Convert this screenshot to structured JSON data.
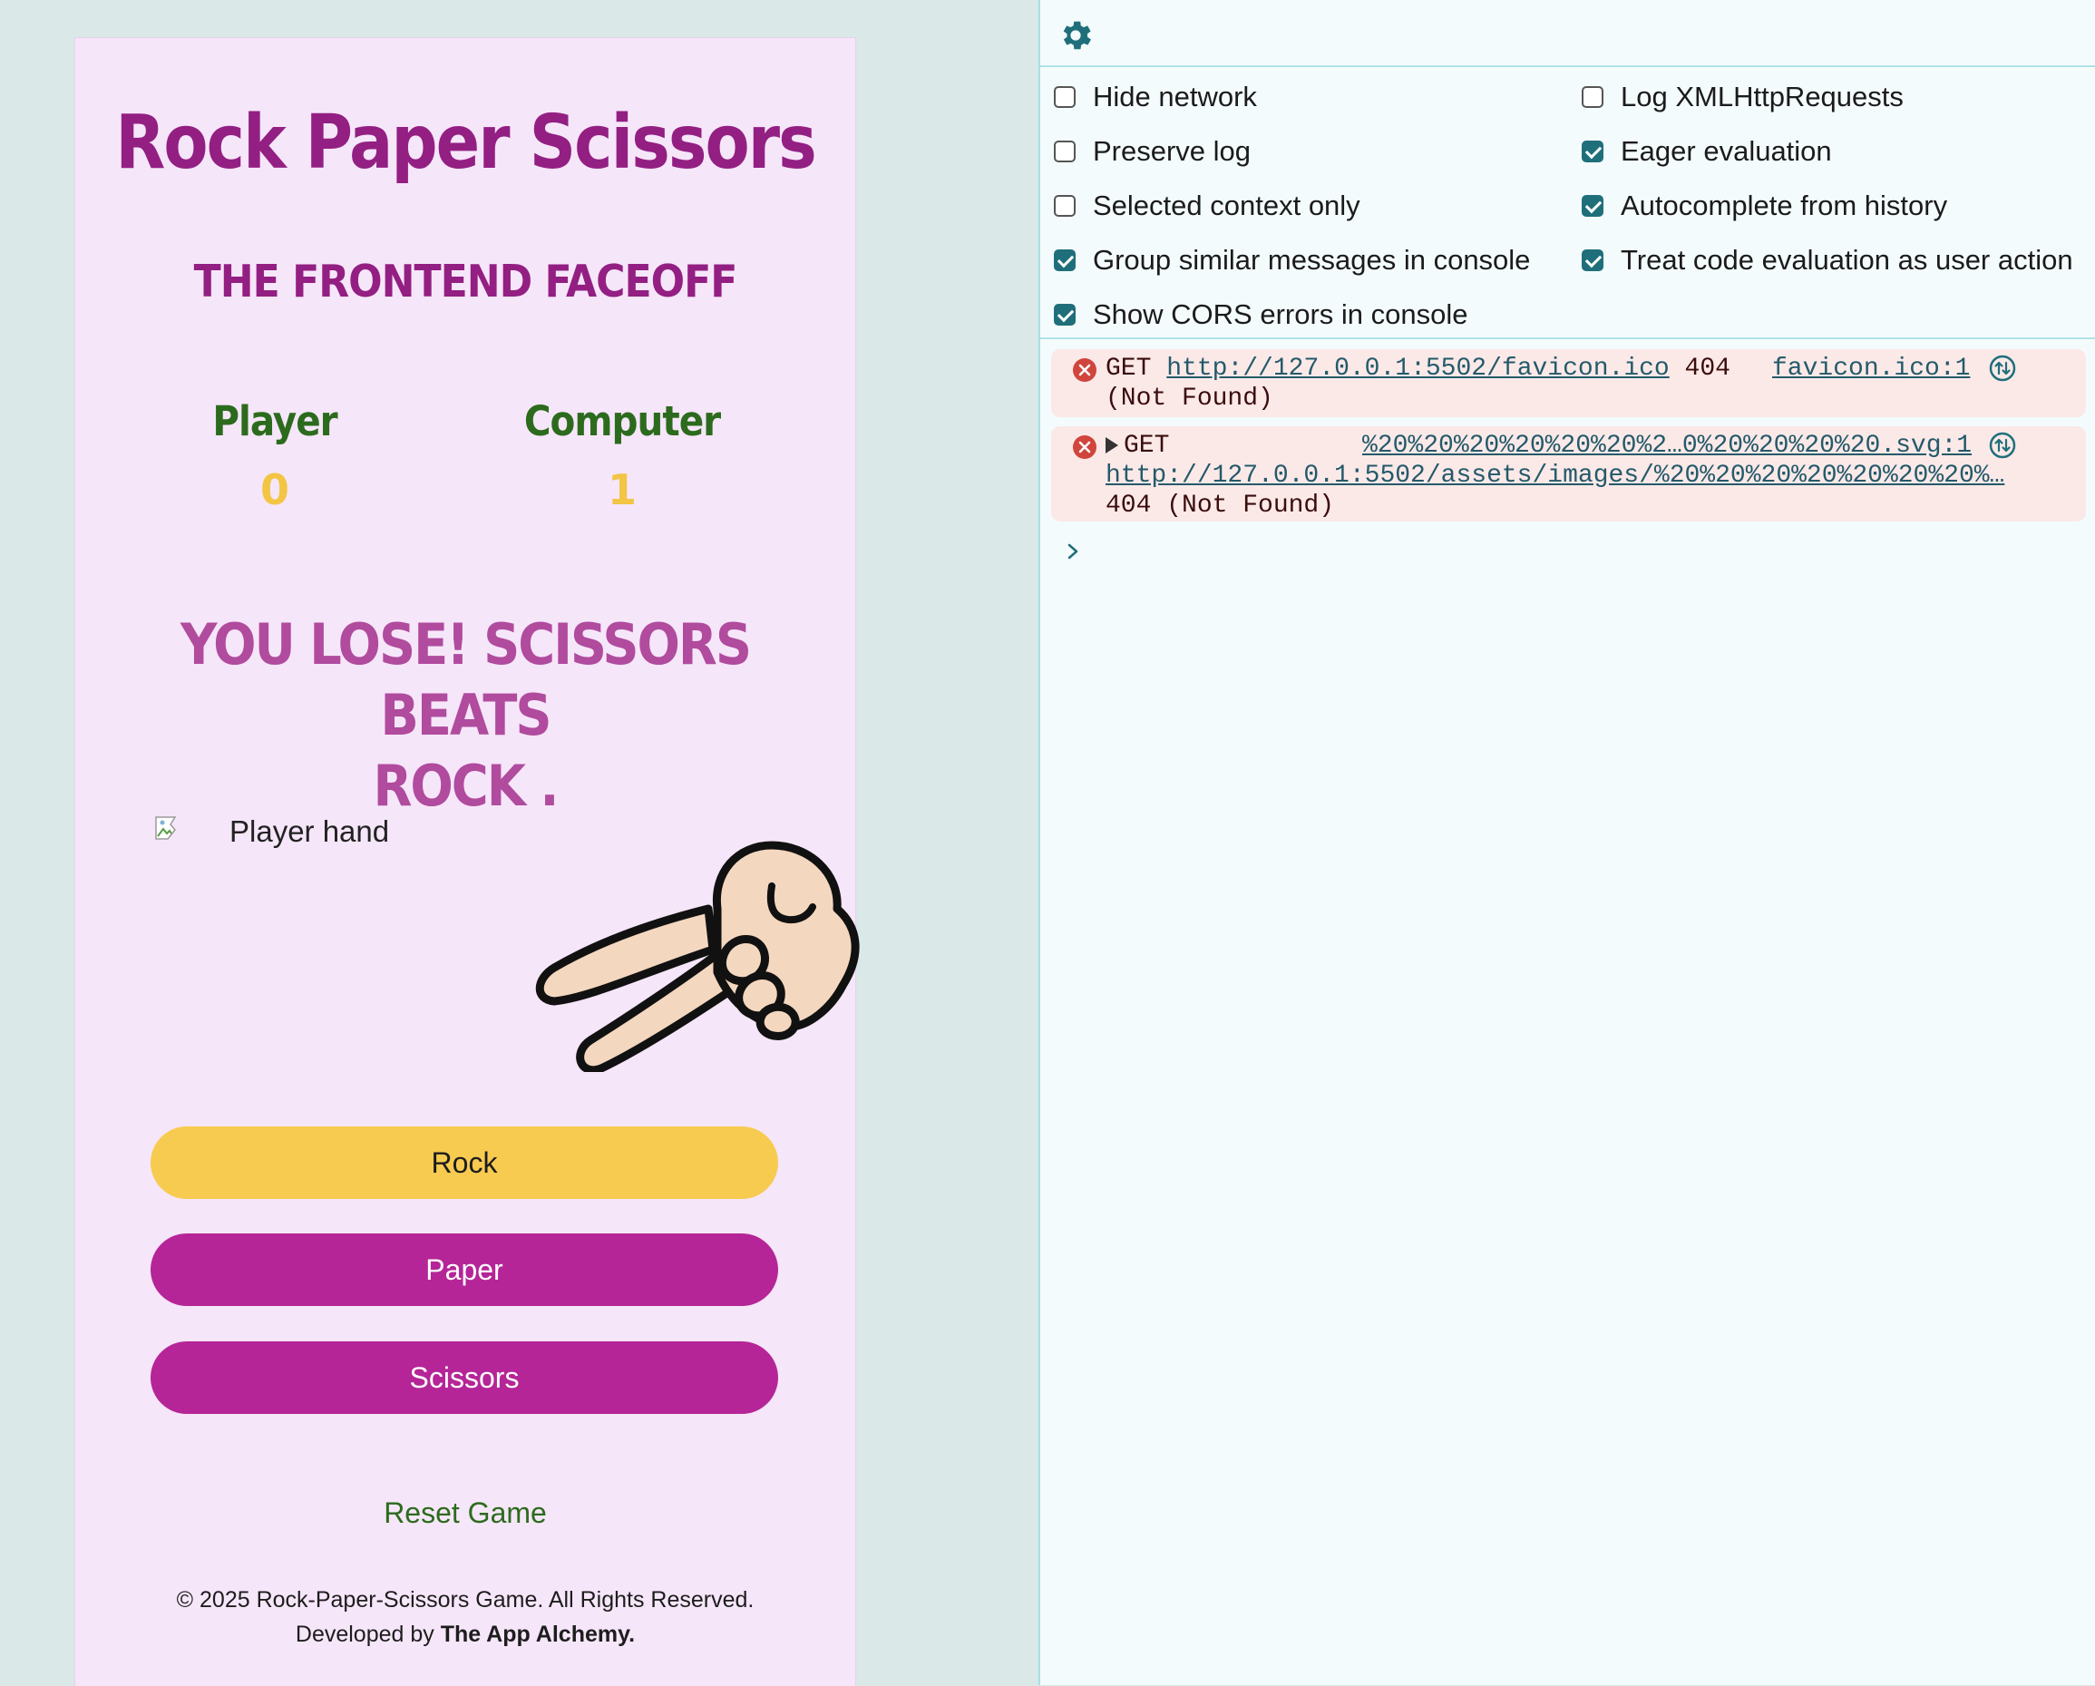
{
  "game": {
    "title": "Rock Paper Scissors",
    "subtitle": "THE FRONTEND FACEOFF",
    "player_label": "Player",
    "player_score": "0",
    "computer_label": "Computer",
    "computer_score": "1",
    "result_line1": "YOU LOSE! SCISSORS BEATS",
    "result_line2": "ROCK .",
    "player_img_alt": "Player hand",
    "buttons": {
      "rock": "Rock",
      "paper": "Paper",
      "scissors": "Scissors"
    },
    "reset_label": "Reset Game",
    "footer_line1": "© 2025 Rock-Paper-Scissors Game. All Rights Reserved.",
    "footer_prefix": "Developed by ",
    "footer_author": "The App Alchemy.",
    "colors": {
      "page_bg": "#dae8e8",
      "card_bg": "#f6e6f9",
      "title": "#931f83",
      "label_green": "#2c6b1d",
      "score_yellow": "#f2c544",
      "result": "#b04b9e",
      "rock_button": "#f7cb50",
      "paper_scissors_button": "#b52597"
    }
  },
  "devtools": {
    "settings_icon": "gear-icon",
    "settings": {
      "hide_network": {
        "label": "Hide network",
        "checked": false
      },
      "log_xhr": {
        "label": "Log XMLHttpRequests",
        "checked": false
      },
      "preserve_log": {
        "label": "Preserve log",
        "checked": false
      },
      "eager_eval": {
        "label": "Eager evaluation",
        "checked": true
      },
      "selected_context": {
        "label": "Selected context only",
        "checked": false
      },
      "autocomplete_history": {
        "label": "Autocomplete from history",
        "checked": true
      },
      "group_similar": {
        "label": "Group similar messages in console",
        "checked": true
      },
      "treat_user_action": {
        "label": "Treat code evaluation as user action",
        "checked": true
      },
      "show_cors": {
        "label": "Show CORS errors in console",
        "checked": true
      }
    },
    "logs": [
      {
        "method": "GET",
        "url": "http://127.0.0.1:5502/favicon.ico",
        "status": "404",
        "status_text": "(Not Found)",
        "source": "favicon.ico:1"
      },
      {
        "method": "GET",
        "url": "http://127.0.0.1:5502/assets/images/%20%20%20%20%20%20%20%…",
        "status_text": "404 (Not Found)",
        "source": "%20%20%20%20%20%20%2…0%20%20%20%20.svg:1"
      }
    ],
    "colors": {
      "panel_bg": "#f4fbfc",
      "checkbox_on": "#1f6f7b",
      "error_bg": "#fbe9e8",
      "error_icon": "#d0453c",
      "link": "#245a6a"
    }
  }
}
